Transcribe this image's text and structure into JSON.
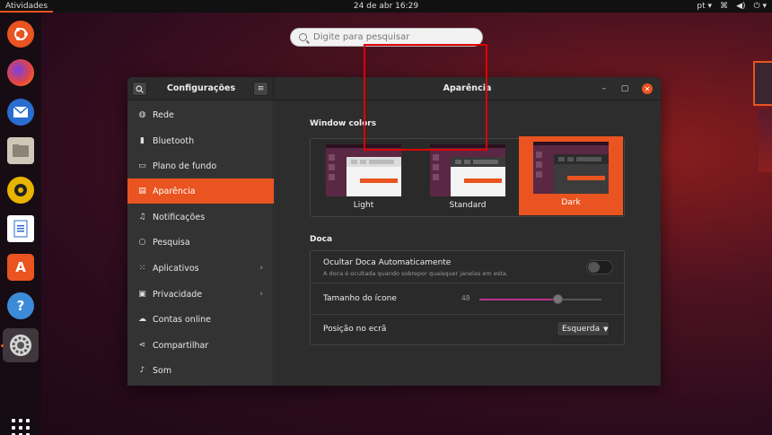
{
  "topbar": {
    "activities": "Atividades",
    "clock": "24 de abr  16:29",
    "lang": "pt"
  },
  "search": {
    "placeholder": "Digite para pesquisar"
  },
  "dock": {
    "items": [
      {
        "name": "ubuntu-icon"
      },
      {
        "name": "firefox-icon"
      },
      {
        "name": "thunderbird-icon"
      },
      {
        "name": "files-icon"
      },
      {
        "name": "rhythmbox-icon"
      },
      {
        "name": "writer-icon"
      },
      {
        "name": "software-icon"
      },
      {
        "name": "help-icon"
      },
      {
        "name": "settings-icon"
      }
    ]
  },
  "window": {
    "left_title": "Configurações",
    "title": "Aparência"
  },
  "sidebar": {
    "items": [
      {
        "label": "Rede",
        "icon": "network-icon"
      },
      {
        "label": "Bluetooth",
        "icon": "bluetooth-icon"
      },
      {
        "label": "Plano de fundo",
        "icon": "background-icon"
      },
      {
        "label": "Aparência",
        "icon": "appearance-icon",
        "active": true
      },
      {
        "label": "Notificações",
        "icon": "bell-icon"
      },
      {
        "label": "Pesquisa",
        "icon": "search-icon"
      },
      {
        "label": "Aplicativos",
        "icon": "apps-icon",
        "chevron": "›"
      },
      {
        "label": "Privacidade",
        "icon": "lock-icon",
        "chevron": "›"
      },
      {
        "label": "Contas online",
        "icon": "cloud-icon"
      },
      {
        "label": "Compartilhar",
        "icon": "share-icon"
      },
      {
        "label": "Som",
        "icon": "music-icon"
      }
    ]
  },
  "appearance": {
    "window_colors_title": "Window colors",
    "themes": [
      {
        "label": "Light"
      },
      {
        "label": "Standard"
      },
      {
        "label": "Dark",
        "selected": true
      }
    ],
    "dock_title": "Doca",
    "autohide_label": "Ocultar Doca Automaticamente",
    "autohide_sub": "A doca é ocultada quando sobrepor quaisquer janelas em esta.",
    "autohide_on": false,
    "icon_size_label": "Tamanho do ícone",
    "icon_size_value": "48",
    "icon_size_fraction": 0.65,
    "position_label": "Posição no ecrã",
    "position_value": "Esquerda"
  },
  "colors": {
    "accent": "#e95420",
    "highlight_outline": "#dd0000"
  }
}
